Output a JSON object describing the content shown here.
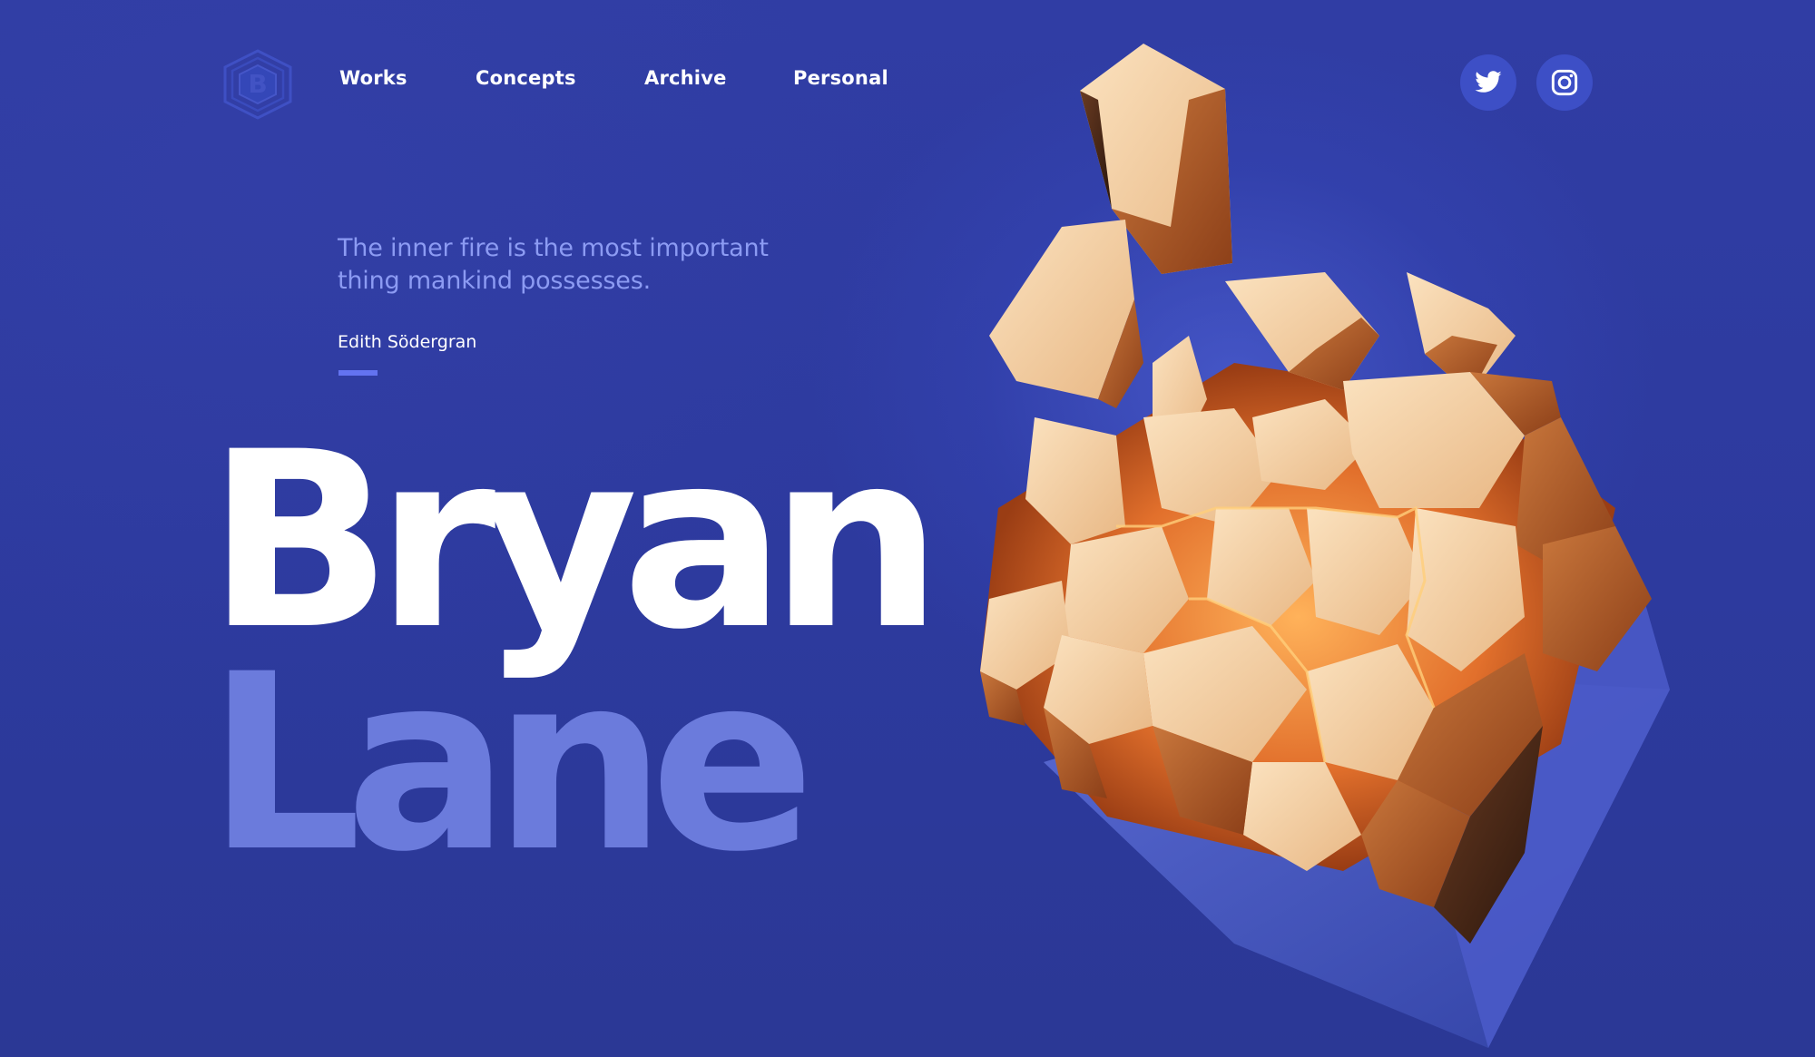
{
  "logo": {
    "letter": "B"
  },
  "nav": {
    "items": [
      {
        "label": "Works"
      },
      {
        "label": "Concepts"
      },
      {
        "label": "Archive"
      },
      {
        "label": "Personal"
      }
    ]
  },
  "social": {
    "twitter_icon": "twitter-icon",
    "instagram_icon": "instagram-icon"
  },
  "hero": {
    "quote_line1": "The inner fire is the most important",
    "quote_line2": "thing mankind possesses.",
    "author": "Edith Södergran",
    "first_name": "Bryan",
    "last_name": "Lane"
  },
  "colors": {
    "background": "#2e3a9c",
    "accent": "#6373f0",
    "quote_text": "#8c9bf3",
    "last_name": "#6b7bdc",
    "gold": "#e8b98a"
  }
}
